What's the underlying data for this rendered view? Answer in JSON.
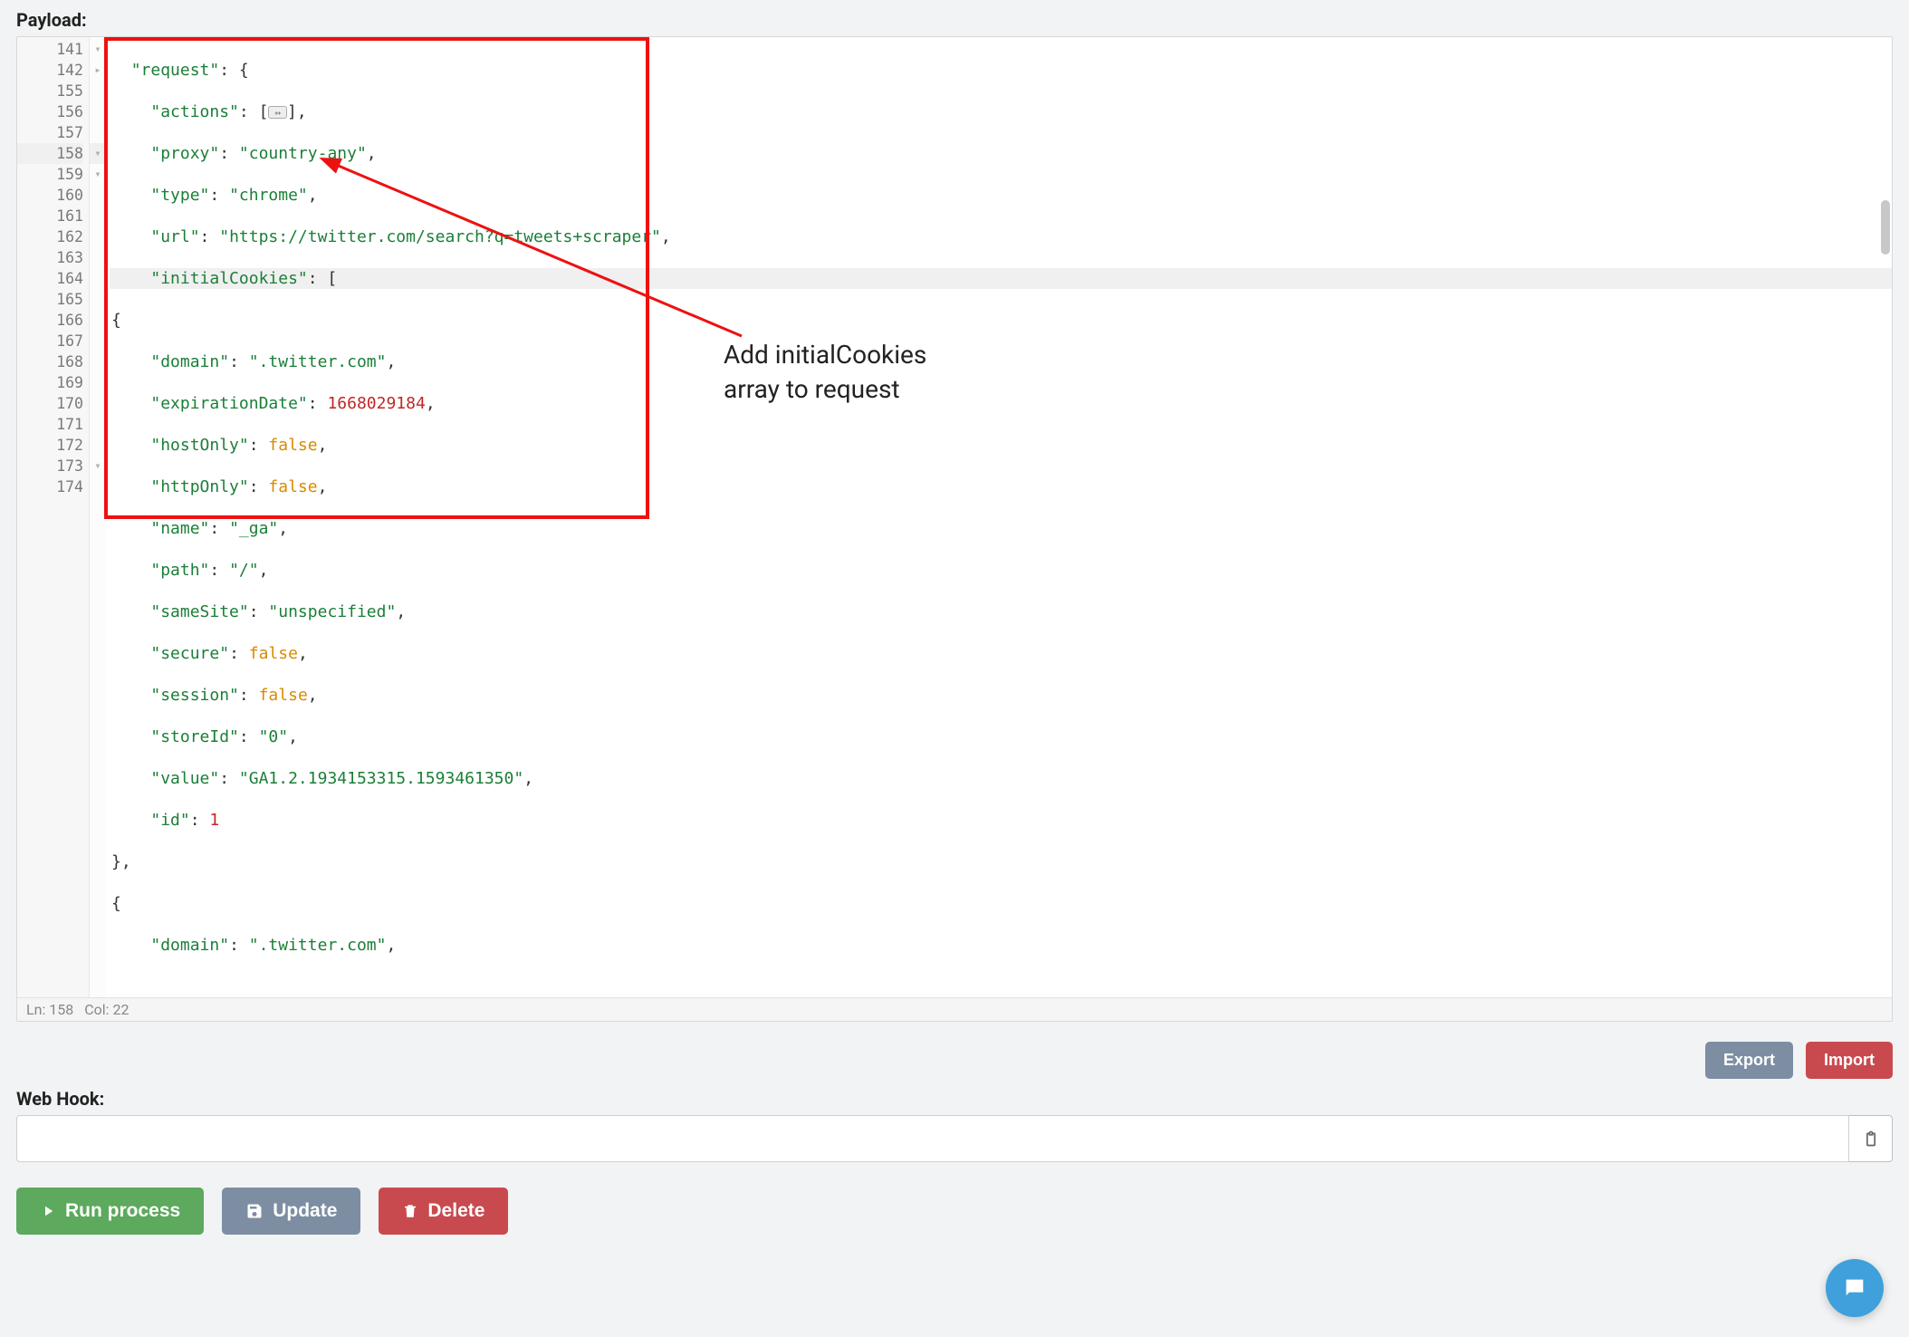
{
  "labels": {
    "payload": "Payload:",
    "webhook": "Web Hook:"
  },
  "editor": {
    "lines": [
      {
        "num": 141,
        "fold": "down"
      },
      {
        "num": 142,
        "fold": "right"
      },
      {
        "num": 155,
        "fold": ""
      },
      {
        "num": 156,
        "fold": ""
      },
      {
        "num": 157,
        "fold": ""
      },
      {
        "num": 158,
        "fold": "down",
        "hl": true
      },
      {
        "num": 159,
        "fold": "down"
      },
      {
        "num": 160,
        "fold": ""
      },
      {
        "num": 161,
        "fold": ""
      },
      {
        "num": 162,
        "fold": ""
      },
      {
        "num": 163,
        "fold": ""
      },
      {
        "num": 164,
        "fold": ""
      },
      {
        "num": 165,
        "fold": ""
      },
      {
        "num": 166,
        "fold": ""
      },
      {
        "num": 167,
        "fold": ""
      },
      {
        "num": 168,
        "fold": ""
      },
      {
        "num": 169,
        "fold": ""
      },
      {
        "num": 170,
        "fold": ""
      },
      {
        "num": 171,
        "fold": ""
      },
      {
        "num": 172,
        "fold": ""
      },
      {
        "num": 173,
        "fold": "down"
      },
      {
        "num": 174,
        "fold": ""
      }
    ],
    "code_tokens": {
      "k_request": "\"request\"",
      "k_actions": "\"actions\"",
      "k_proxy": "\"proxy\"",
      "v_proxy": "\"country-any\"",
      "k_type": "\"type\"",
      "v_type": "\"chrome\"",
      "k_url": "\"url\"",
      "v_url": "\"https://twitter.com/search?q=tweets+scraper\"",
      "k_initialCookies": "\"initialCookies\"",
      "k_domain": "\"domain\"",
      "v_domain": "\".twitter.com\"",
      "k_expirationDate": "\"expirationDate\"",
      "v_expirationDate": "1668029184",
      "k_hostOnly": "\"hostOnly\"",
      "k_httpOnly": "\"httpOnly\"",
      "k_name": "\"name\"",
      "v_name": "\"_ga\"",
      "k_path": "\"path\"",
      "v_path": "\"/\"",
      "k_sameSite": "\"sameSite\"",
      "v_sameSite": "\"unspecified\"",
      "k_secure": "\"secure\"",
      "k_session": "\"session\"",
      "k_storeId": "\"storeId\"",
      "v_storeId": "\"0\"",
      "k_value": "\"value\"",
      "v_value": "\"GA1.2.1934153315.1593461350\"",
      "k_id": "\"id\"",
      "v_id": "1",
      "v_false": "false"
    },
    "status": {
      "ln_label": "Ln:",
      "ln": "158",
      "col_label": "Col:",
      "col": "22"
    }
  },
  "buttons": {
    "export": "Export",
    "import": "Import",
    "run": "Run process",
    "update": "Update",
    "delete": "Delete"
  },
  "webhook": {
    "value": ""
  },
  "annotation": {
    "line1": "Add initialCookies",
    "line2": "array to request"
  }
}
